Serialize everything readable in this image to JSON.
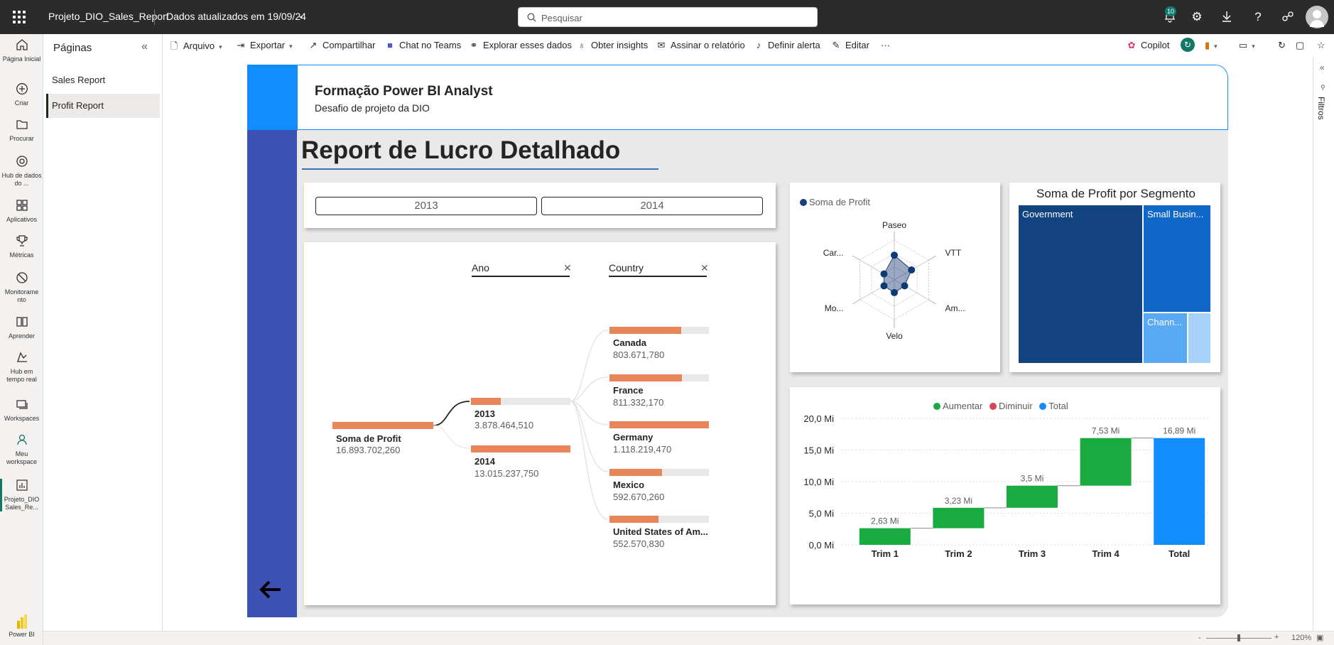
{
  "topbar": {
    "app_name": "Projeto_DIO_Sales_Report",
    "data_updated": "Dados atualizados em 19/09/24",
    "search_placeholder": "Pesquisar",
    "notifications_count": "10"
  },
  "leftnav": [
    {
      "label": "Página Inicial",
      "icon": "home-icon"
    },
    {
      "label": "Criar",
      "icon": "plus-circle-icon"
    },
    {
      "label": "Procurar",
      "icon": "folder-icon"
    },
    {
      "label": "Hub de dados do ...",
      "icon": "data-hub-icon"
    },
    {
      "label": "Aplicativos",
      "icon": "apps-icon"
    },
    {
      "label": "Métricas",
      "icon": "trophy-icon"
    },
    {
      "label": "Monitoramento",
      "icon": "monitor-icon"
    },
    {
      "label": "Aprender",
      "icon": "book-icon"
    },
    {
      "label": "Hub em tempo real",
      "icon": "realtime-hub-icon"
    },
    {
      "label": "Workspaces",
      "icon": "workspaces-icon"
    },
    {
      "label": "Meu workspace",
      "icon": "person-icon"
    },
    {
      "label": "Projeto_DIO Sales_Re...",
      "icon": "report-icon"
    }
  ],
  "powerbi_label": "Power BI",
  "pages": {
    "title": "Páginas",
    "items": [
      "Sales Report",
      "Profit Report"
    ],
    "selected": "Profit Report"
  },
  "toolbar": {
    "arquivo": "Arquivo",
    "exportar": "Exportar",
    "compartilhar": "Compartilhar",
    "chat_teams": "Chat no Teams",
    "explorar": "Explorar esses dados",
    "insights": "Obter insights",
    "assinar": "Assinar o relatório",
    "alerta": "Definir alerta",
    "editar": "Editar",
    "more": "···",
    "copilot": "Copilot"
  },
  "filters_label": "Filtros",
  "statusbar": {
    "zoom": "120%"
  },
  "report": {
    "header_title": "Formação Power BI Analyst",
    "header_subtitle": "Desafio de projeto da DIO",
    "title": "Report de Lucro Detalhado",
    "slicer": [
      "2013",
      "2014"
    ],
    "decomposition": {
      "level1_header": "Ano",
      "level2_header": "Country",
      "root": {
        "label": "Soma de Profit",
        "value": "16.893.702,260"
      },
      "years": [
        {
          "label": "2013",
          "value": "3.878.464,510",
          "fill": 0.3
        },
        {
          "label": "2014",
          "value": "13.015.237,750",
          "fill": 1.0
        }
      ],
      "countries": [
        {
          "label": "Canada",
          "value": "803.671,780",
          "fill": 0.72
        },
        {
          "label": "France",
          "value": "811.332,170",
          "fill": 0.73
        },
        {
          "label": "Germany",
          "value": "1.118.219,470",
          "fill": 1.0
        },
        {
          "label": "Mexico",
          "value": "592.670,260",
          "fill": 0.53
        },
        {
          "label": "United States of Am...",
          "value": "552.570,830",
          "fill": 0.49
        }
      ]
    },
    "radar": {
      "legend": "Soma de Profit",
      "axes": [
        "Paseo",
        "VTT",
        "Am...",
        "Velo",
        "Mo...",
        "Car..."
      ],
      "values": [
        0.62,
        0.5,
        0.3,
        0.32,
        0.3,
        0.3
      ]
    },
    "treemap": {
      "title": "Soma de Profit por Segmento",
      "segments": [
        "Government",
        "Small Busin...",
        "Chann...",
        ""
      ]
    },
    "waterfall": {
      "legend": [
        "Aumentar",
        "Diminuir",
        "Total"
      ],
      "colors": {
        "increase": "#1aab40",
        "decrease": "#d64550",
        "total": "#118dff"
      }
    }
  },
  "chart_data": {
    "type": "bar",
    "subtype": "waterfall",
    "categories": [
      "Trim 1",
      "Trim 2",
      "Trim 3",
      "Trim 4",
      "Total"
    ],
    "values": [
      2.63,
      3.23,
      3.5,
      7.53,
      16.89
    ],
    "data_labels": [
      "2,63 Mi",
      "3,23 Mi",
      "3,5 Mi",
      "7,53 Mi",
      "16,89 Mi"
    ],
    "y_ticks": [
      "0,0 Mi",
      "5,0 Mi",
      "10,0 Mi",
      "15,0 Mi",
      "20,0 Mi"
    ],
    "ylim": [
      0,
      20
    ],
    "legend": [
      "Aumentar",
      "Diminuir",
      "Total"
    ],
    "legend_position": "top"
  }
}
